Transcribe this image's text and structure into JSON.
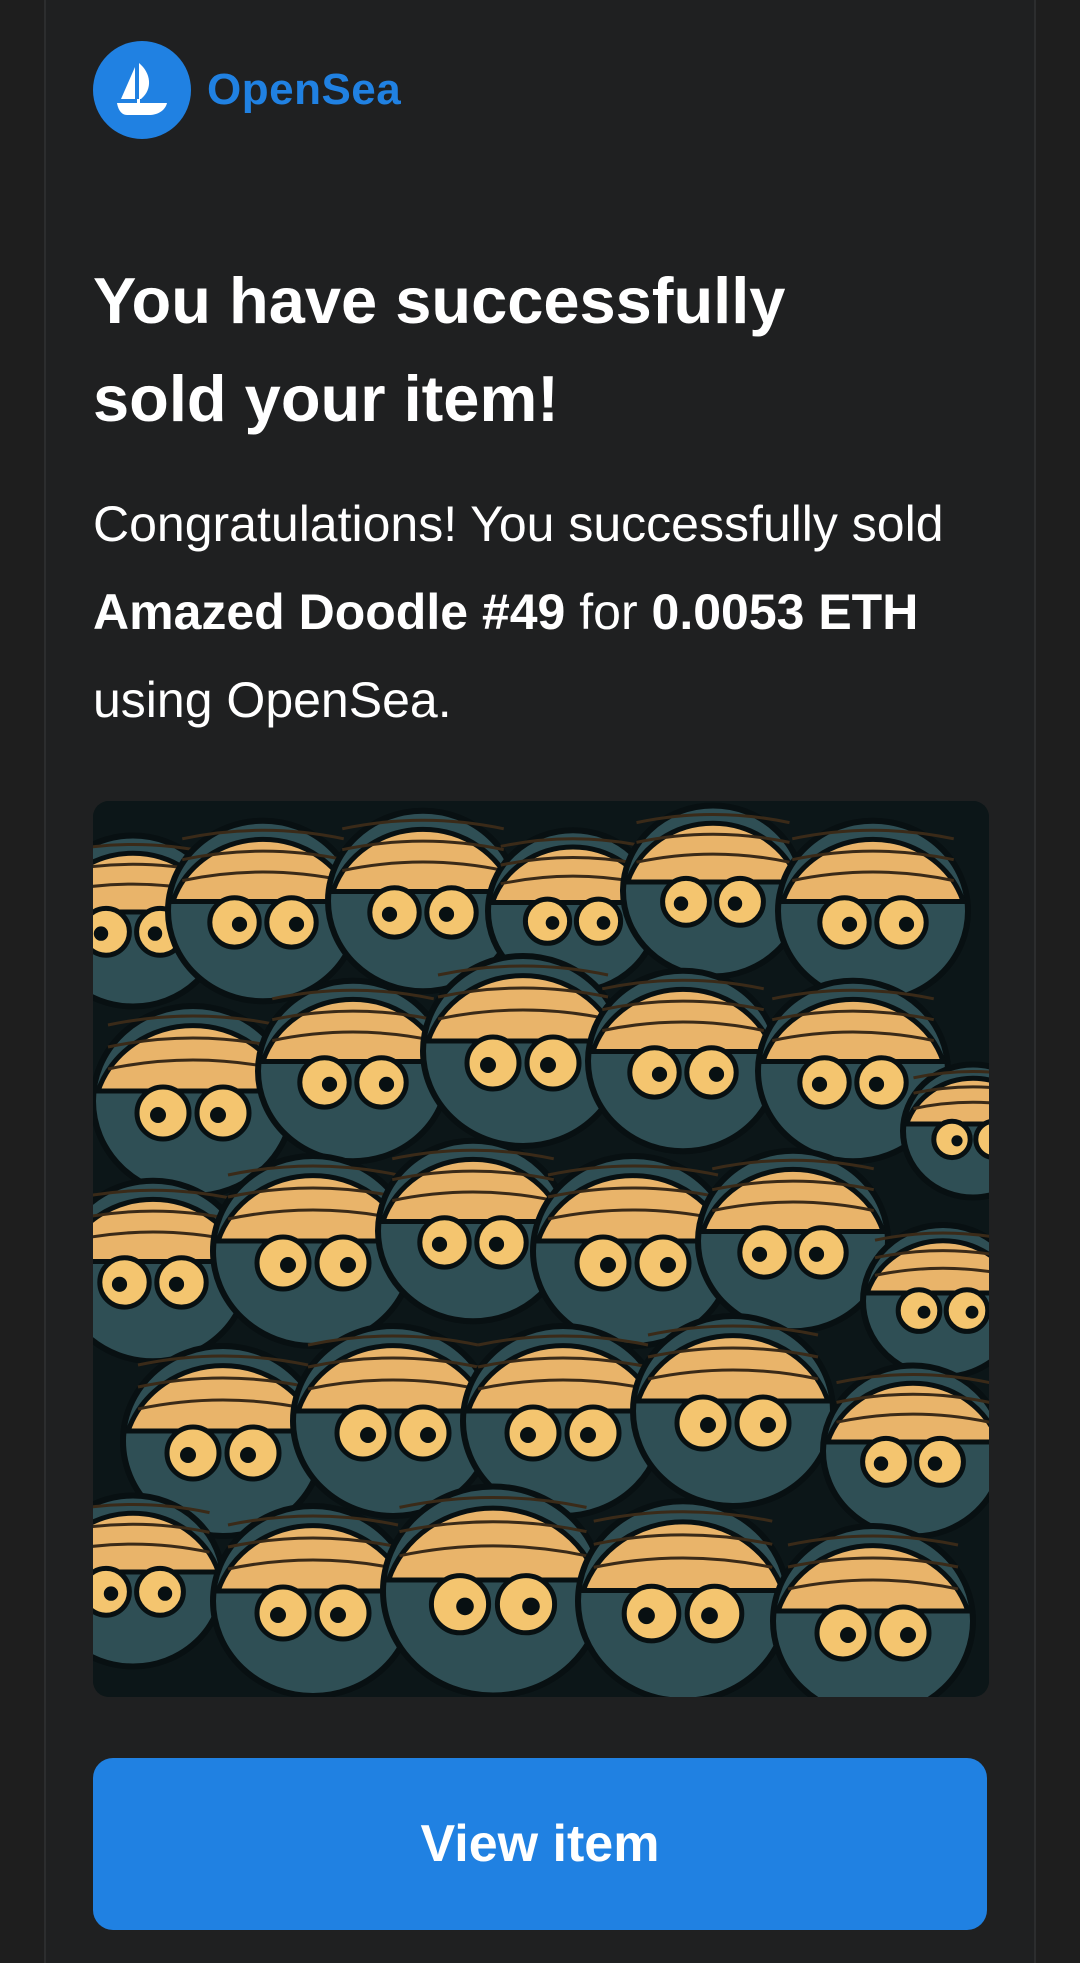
{
  "brand": {
    "name": "OpenSea",
    "color": "#2081e2",
    "logo_icon": "sailboat-icon"
  },
  "headline": {
    "line1": "You have successfully",
    "line2": "sold your item!"
  },
  "message": {
    "intro": "Congratulations! You successfully sold ",
    "item_name": "Amazed Doodle #49",
    "for_text": " for ",
    "price": "0.0053 ETH",
    "outro": " using OpenSea."
  },
  "image": {
    "icon": "nft-artwork-image",
    "palette": [
      "#e9b46a",
      "#2f4f55",
      "#0c1618",
      "#f4c56f"
    ]
  },
  "cta": {
    "label": "View item"
  }
}
